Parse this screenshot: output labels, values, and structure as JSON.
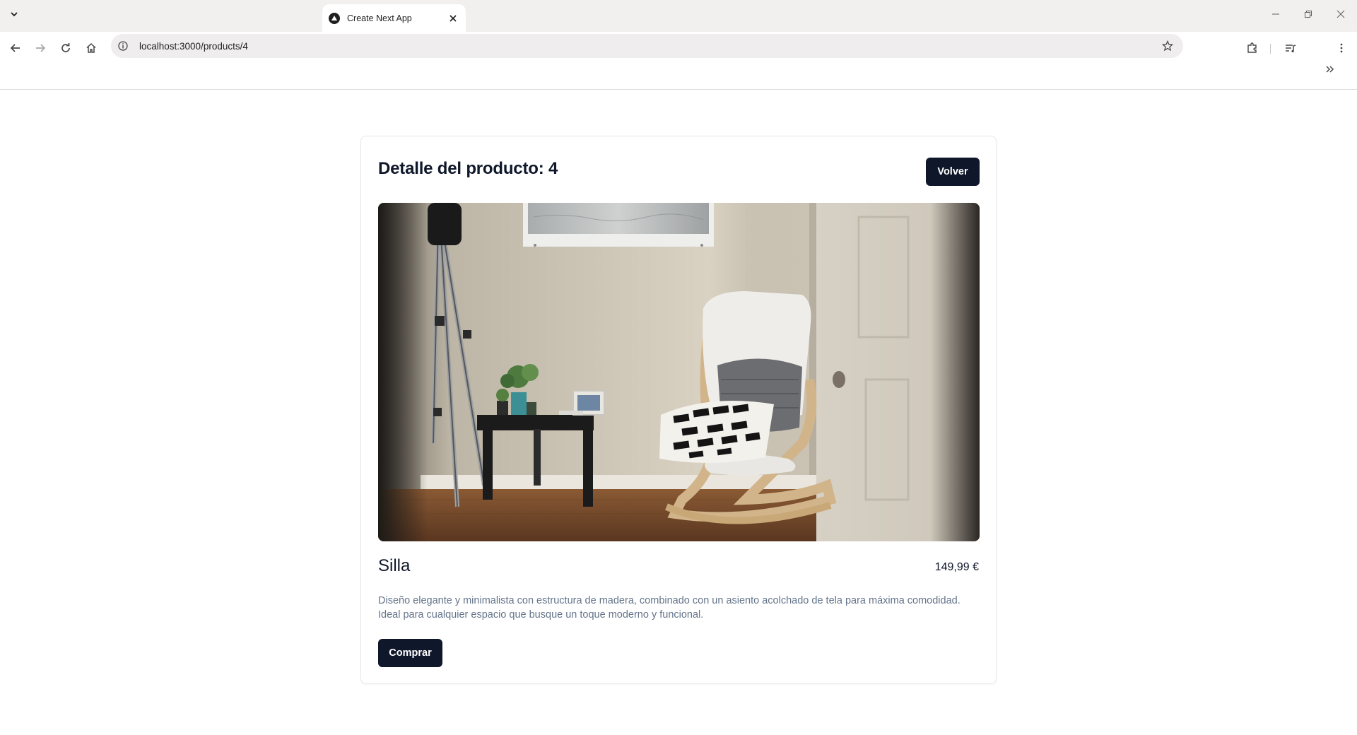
{
  "browser": {
    "tab_title": "Create Next App",
    "url": "localhost:3000/products/4"
  },
  "page": {
    "title": "Detalle del producto: 4",
    "back_button": "Volver",
    "product": {
      "name": "Silla",
      "price": "149,99 €",
      "description_line1": "Diseño elegante y minimalista con estructura de madera, combinado con un asiento acolchado de tela para máxima comodidad.",
      "description_line2": "Ideal para cualquier espacio que busque un toque moderno y funcional.",
      "buy_button": "Comprar"
    }
  },
  "colors": {
    "primary_button": "#0f172a",
    "muted_text": "#64748b",
    "border": "#e5e7eb"
  }
}
